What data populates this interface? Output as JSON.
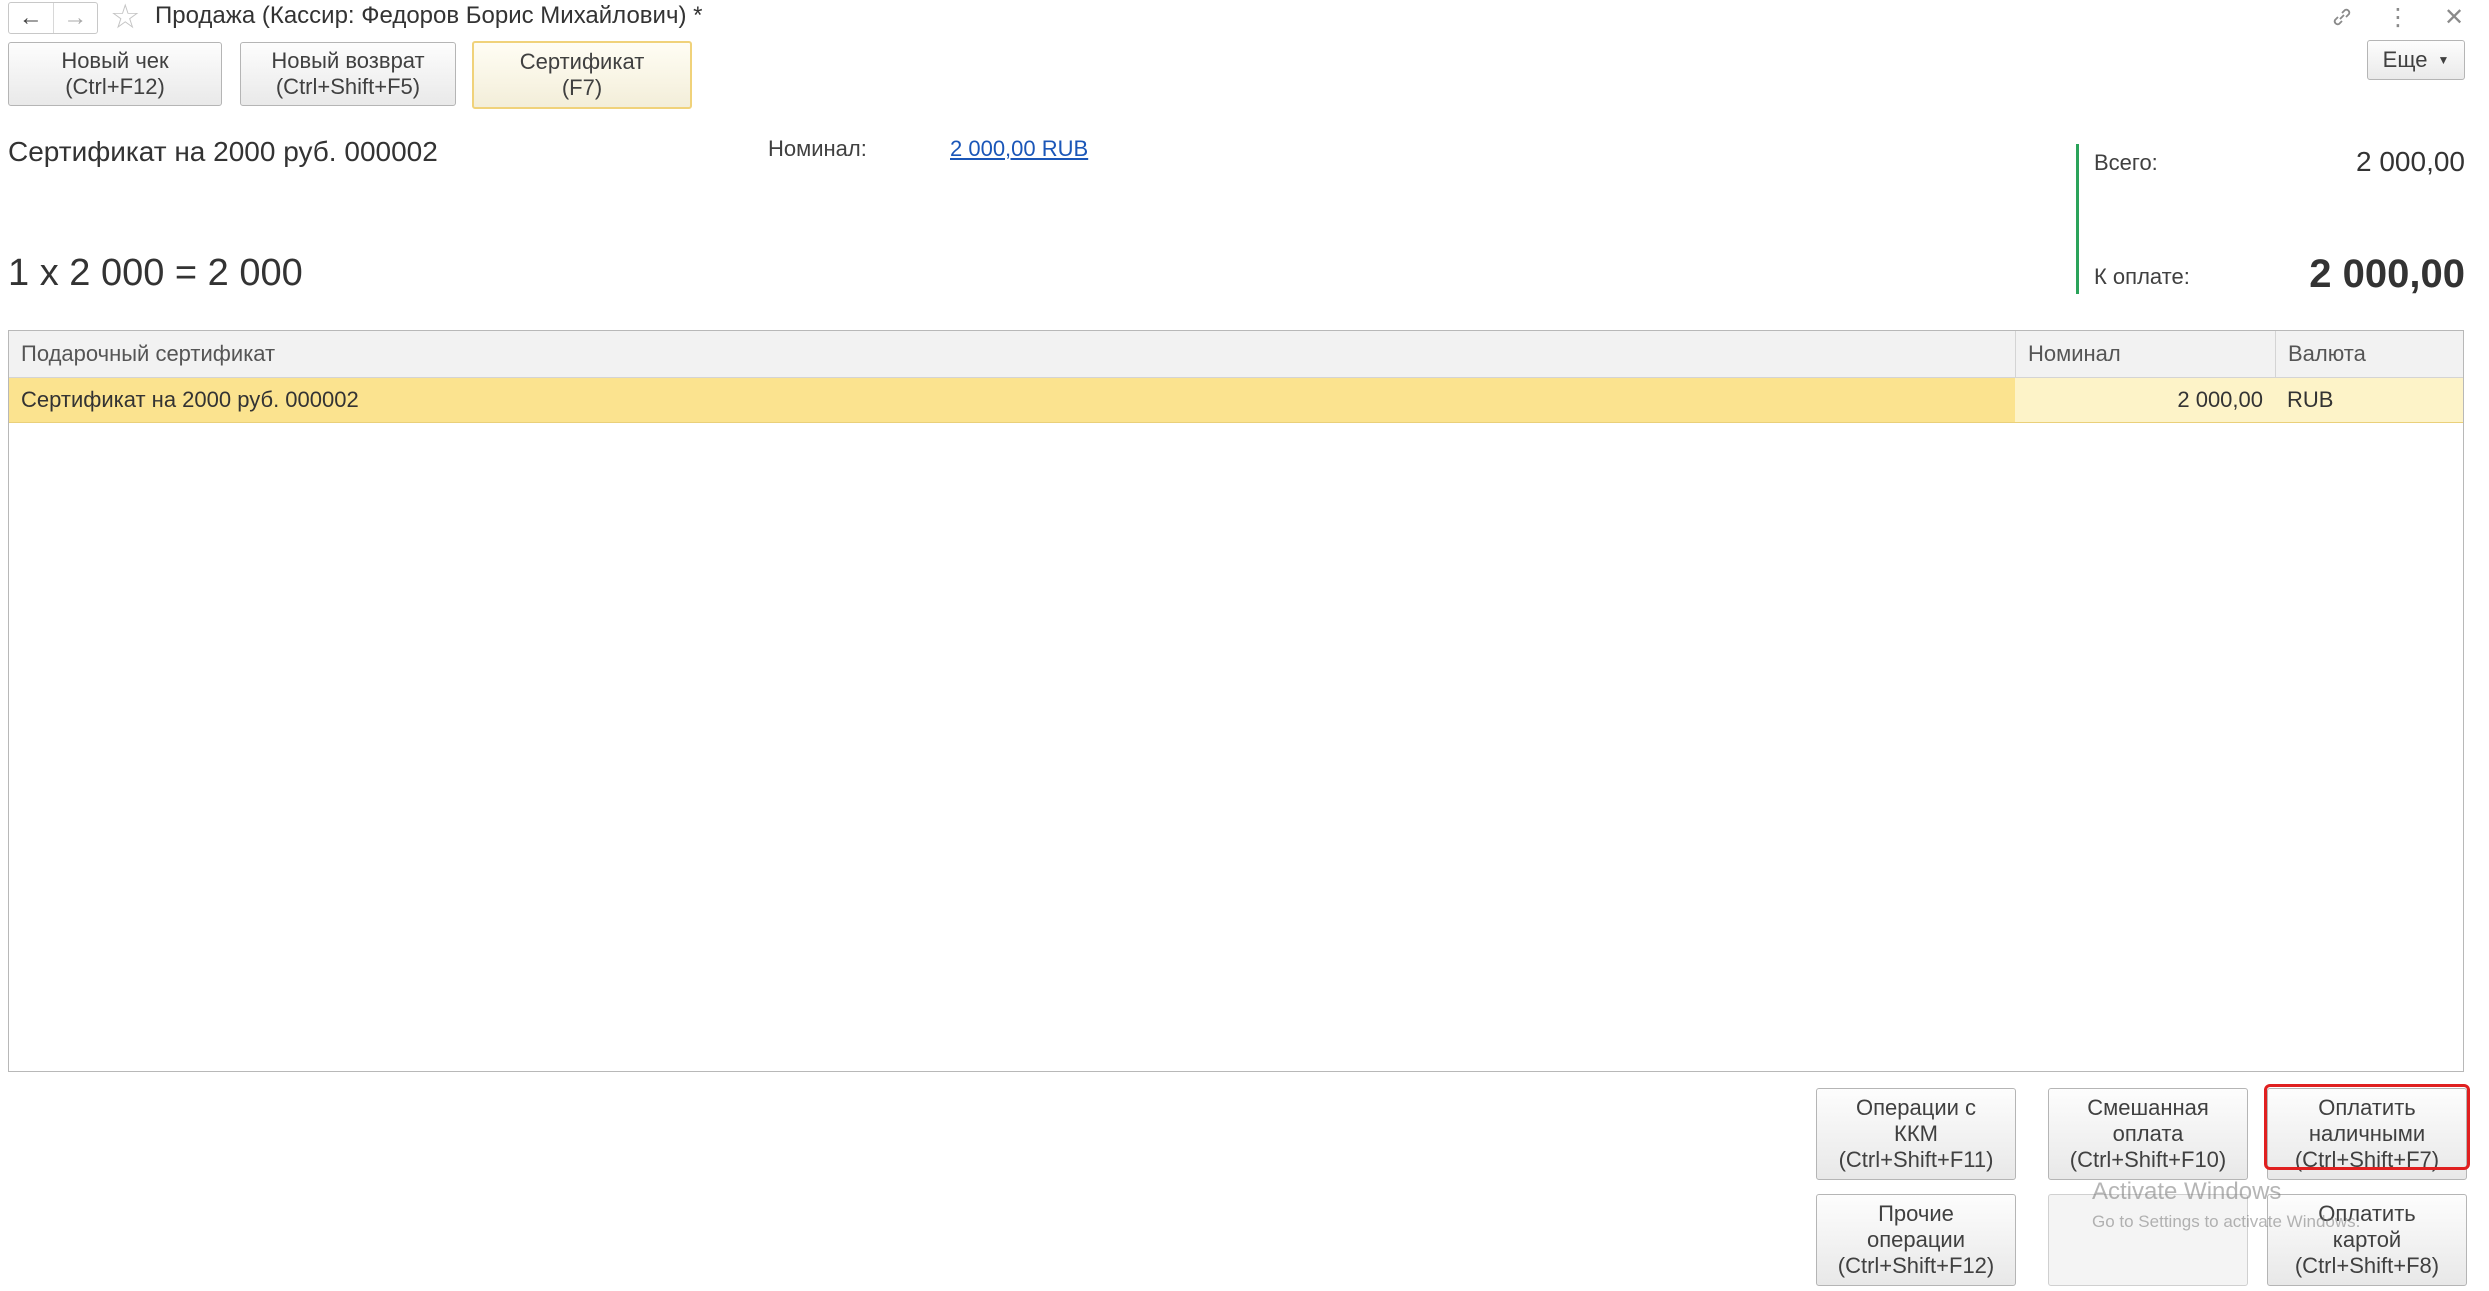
{
  "window": {
    "title": "Продажа (Кассир: Федоров Борис Михайлович) *"
  },
  "toolbar": {
    "new_check": {
      "line1": "Новый чек",
      "line2": "(Ctrl+F12)"
    },
    "new_return": {
      "line1": "Новый возврат",
      "line2": "(Ctrl+Shift+F5)"
    },
    "certificate": {
      "line1": "Сертификат",
      "line2": "(F7)"
    },
    "more_label": "Еще"
  },
  "info": {
    "item_name": "Сертификат на 2000 руб. 000002",
    "nominal_label": "Номинал:",
    "nominal_value": "2 000,00 RUB",
    "calc_line": "1 x 2 000 = 2 000"
  },
  "totals": {
    "total_label": "Всего:",
    "total_value": "2 000,00",
    "pay_label": "К оплате:",
    "pay_value": "2 000,00"
  },
  "table": {
    "headers": [
      "Подарочный сертификат",
      "Номинал",
      "Валюта"
    ],
    "rows": [
      {
        "name": "Сертификат на 2000 руб. 000002",
        "nominal": "2 000,00",
        "currency": "RUB"
      }
    ]
  },
  "actions": {
    "kkm_ops": {
      "line1": "Операции с",
      "line2": "ККМ",
      "line3": "(Ctrl+Shift+F11)"
    },
    "mixed_pay": {
      "line1": "Смешанная",
      "line2": "оплата",
      "line3": "(Ctrl+Shift+F10)"
    },
    "cash_pay": {
      "line1": "Оплатить",
      "line2": "наличными",
      "line3": "(Ctrl+Shift+F7)"
    },
    "other_ops": {
      "line1": "Прочие",
      "line2": "операции",
      "line3": "(Ctrl+Shift+F12)"
    },
    "card_pay": {
      "line1": "Оплатить",
      "line2": "картой",
      "line3": "(Ctrl+Shift+F8)"
    }
  },
  "watermark": {
    "line1": "Activate Windows",
    "line2": "Go to Settings to activate Windows."
  },
  "colors": {
    "selected_row": "#fbe38f",
    "accent_green": "#2aa35a",
    "link_blue": "#1a56b8",
    "highlight_red": "#e02020"
  }
}
